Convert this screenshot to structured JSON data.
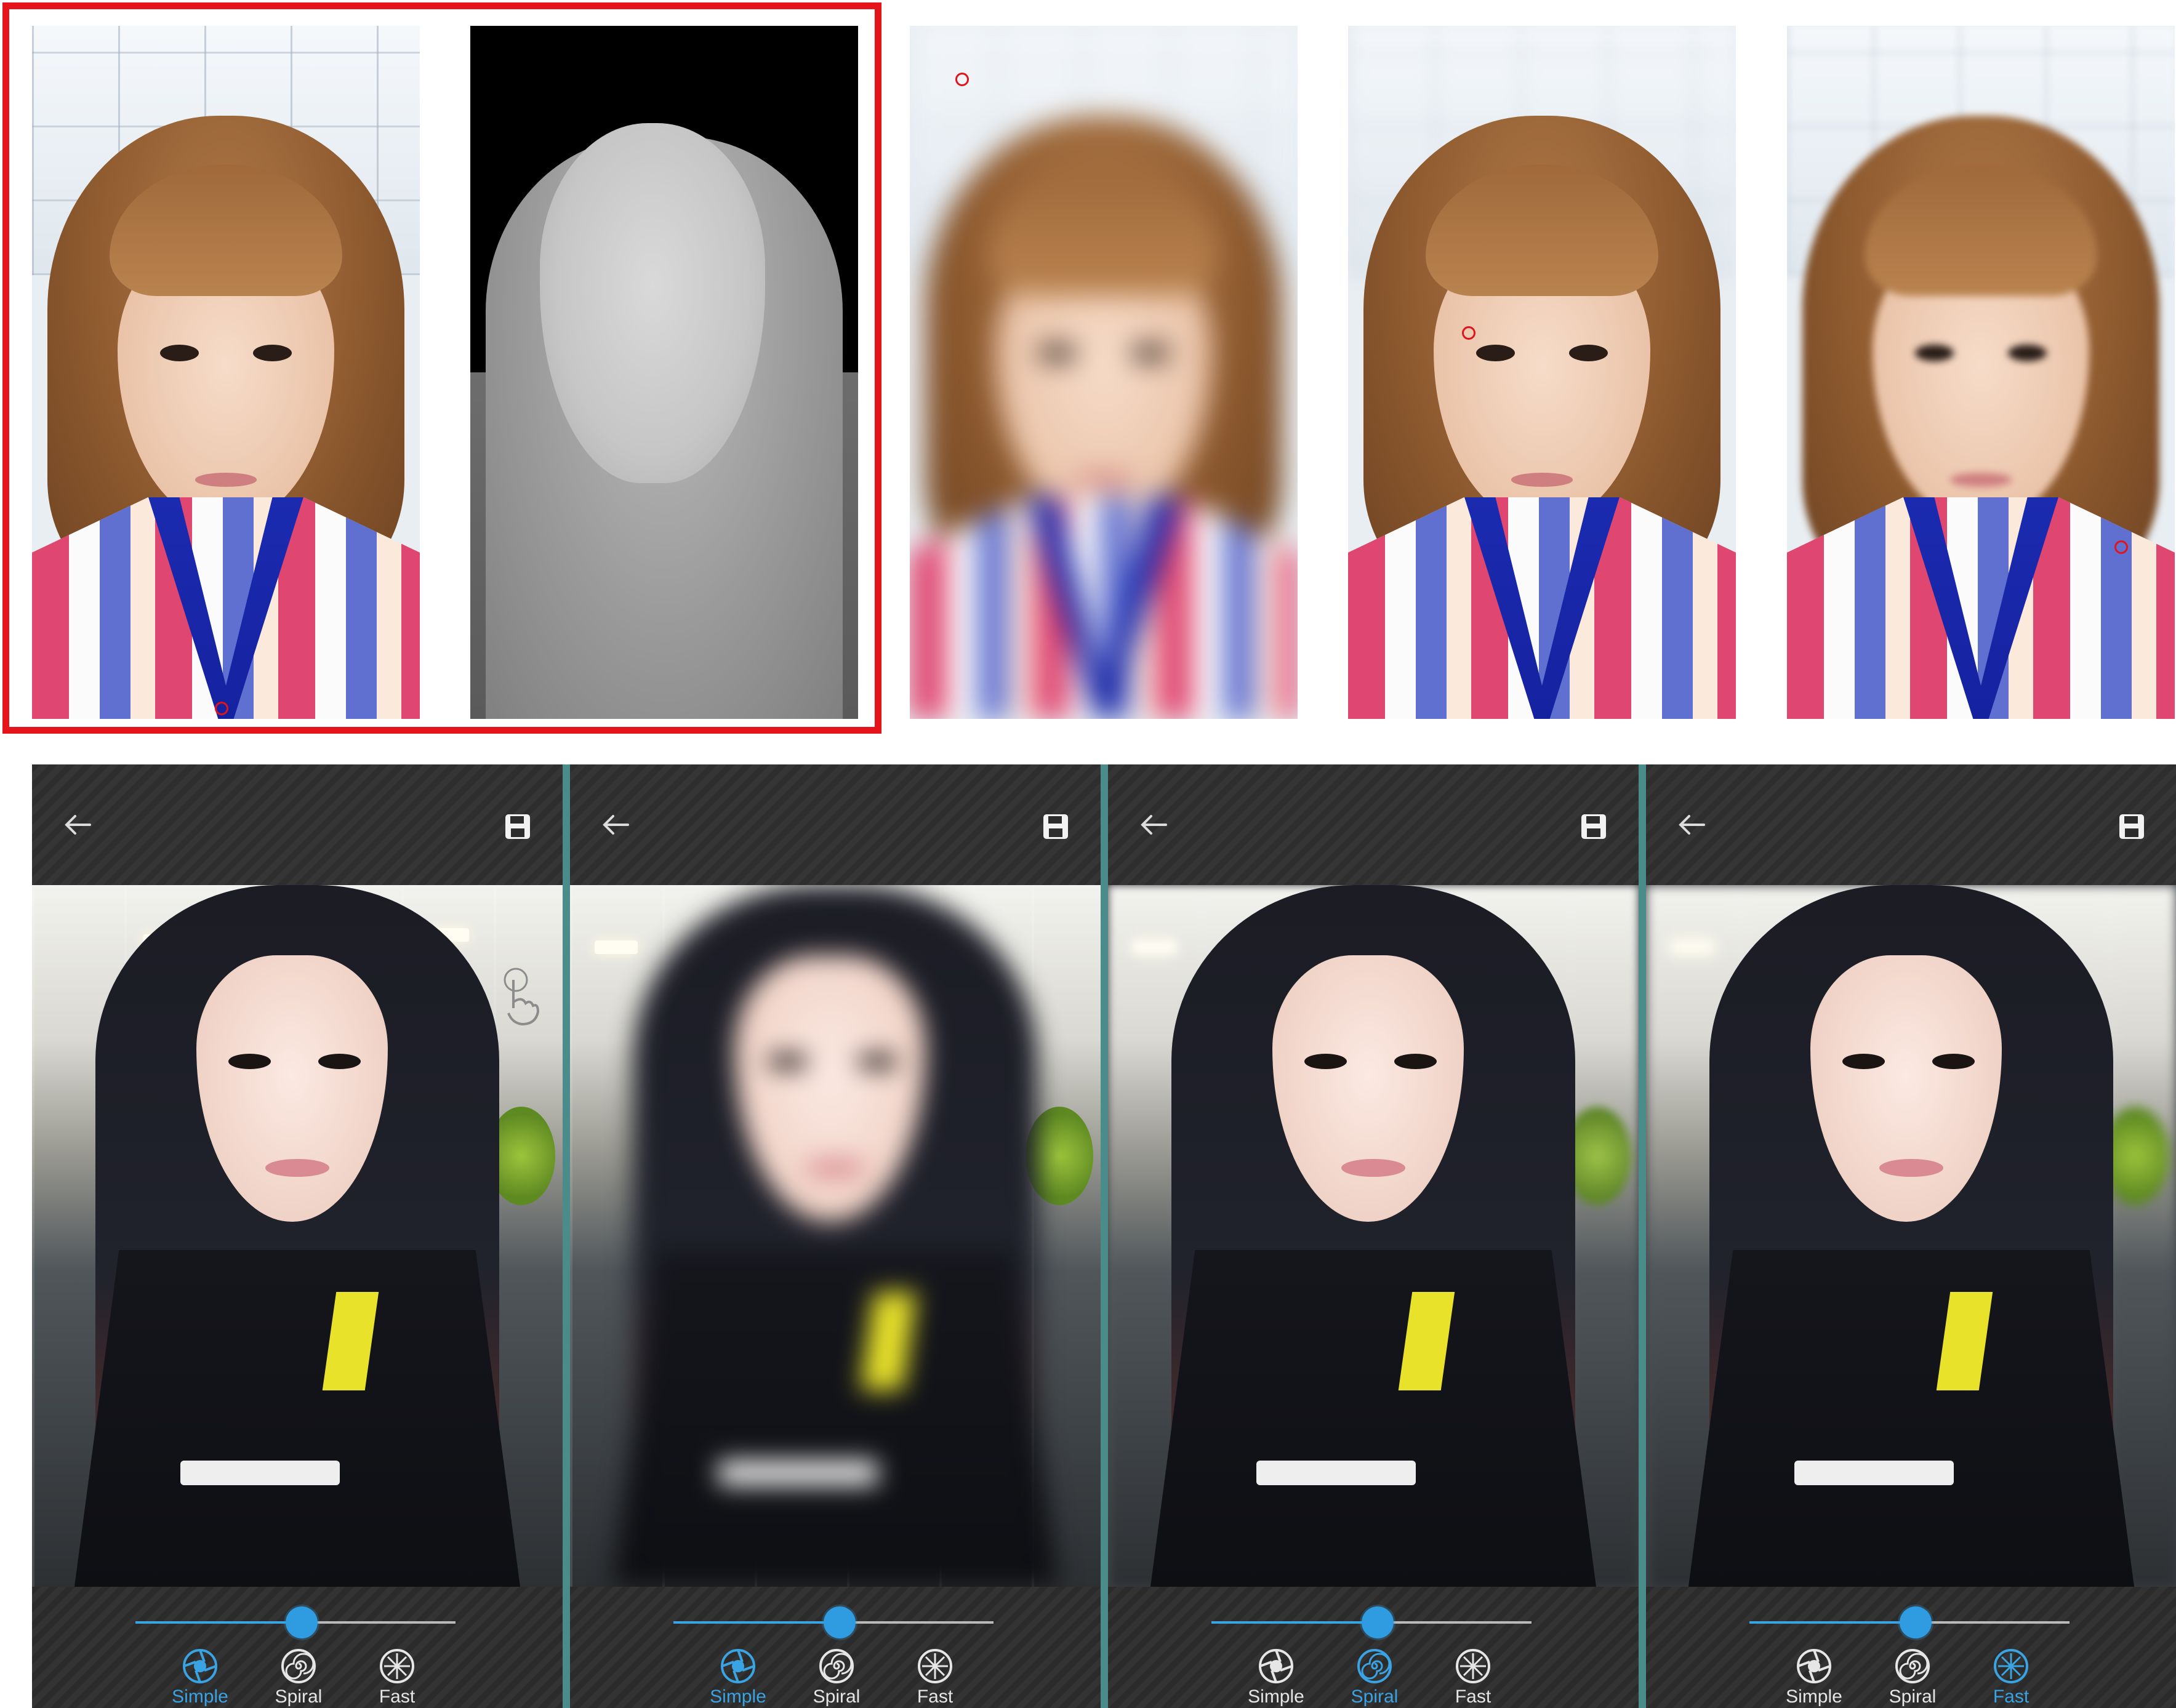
{
  "screens": [
    {
      "modes": [
        {
          "label": "Simple",
          "icon": "aperture-icon",
          "active": true
        },
        {
          "label": "Spiral",
          "icon": "spiral-icon",
          "active": false
        },
        {
          "label": "Fast",
          "icon": "radial-burst-icon",
          "active": false
        }
      ],
      "slider_level": 0.52
    },
    {
      "modes": [
        {
          "label": "Simple",
          "icon": "aperture-icon",
          "active": true
        },
        {
          "label": "Spiral",
          "icon": "spiral-icon",
          "active": false
        },
        {
          "label": "Fast",
          "icon": "radial-burst-icon",
          "active": false
        }
      ],
      "slider_level": 0.52
    },
    {
      "modes": [
        {
          "label": "Simple",
          "icon": "aperture-icon",
          "active": false
        },
        {
          "label": "Spiral",
          "icon": "spiral-icon",
          "active": true
        },
        {
          "label": "Fast",
          "icon": "radial-burst-icon",
          "active": false
        }
      ],
      "slider_level": 0.52
    },
    {
      "modes": [
        {
          "label": "Simple",
          "icon": "aperture-icon",
          "active": false
        },
        {
          "label": "Spiral",
          "icon": "spiral-icon",
          "active": false
        },
        {
          "label": "Fast",
          "icon": "radial-burst-icon",
          "active": true
        }
      ],
      "slider_level": 0.52
    }
  ],
  "colors": {
    "highlight_border": "#e5141a",
    "accent": "#3aa3e3",
    "divider": "#4a8c8a",
    "toolbar": "#2c2c2c"
  }
}
